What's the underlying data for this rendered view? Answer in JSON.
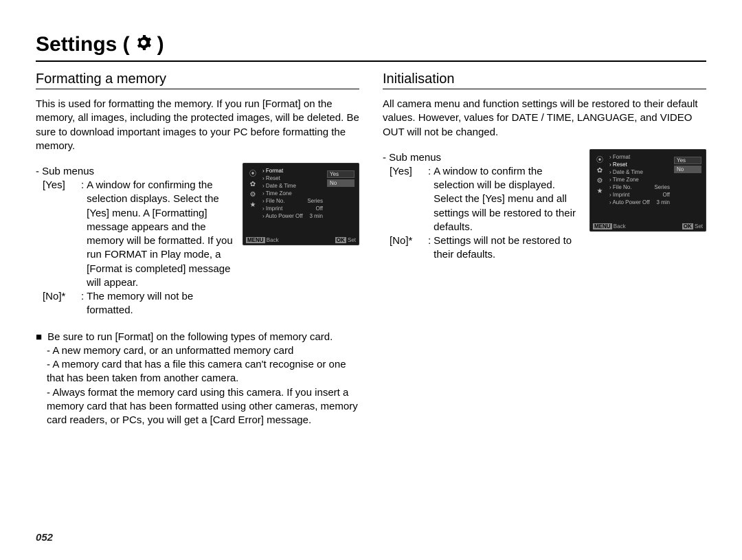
{
  "title_text": "Settings (",
  "title_close": ")",
  "page_number": "052",
  "left": {
    "heading": "Formatting a memory",
    "intro": "This is used for formatting the memory. If you run [Format] on the memory, all images, including the protected images, will be deleted. Be sure to download important images to your PC before formatting the memory.",
    "sub_menus_label": "- Sub menus",
    "yes_label": "[Yes]",
    "yes_text": "A window for confirming the selection displays. Select the [Yes] menu. A [Formatting] message appears and the memory will be formatted. If you run FORMAT in Play mode, a [Format is completed] message will appear.",
    "no_label": "[No]*",
    "no_text": "The memory will not be formatted.",
    "bullet_lead": "Be sure to run [Format] on the following types of memory card.",
    "bullet_a": "- A new memory card, or an unformatted memory card",
    "bullet_b": "- A memory card that has a file this camera can't recognise or one that has been taken from another camera.",
    "bullet_c": "- Always format the memory card using this camera. If you insert a memory card that has been formatted using other cameras, memory card readers, or PCs, you will get a [Card Error] message."
  },
  "right": {
    "heading": "Initialisation",
    "intro": "All camera menu and function settings will be restored to their default values. However, values for DATE / TIME, LANGUAGE, and VIDEO OUT will not be changed.",
    "sub_menus_label": "- Sub menus",
    "yes_label": "[Yes]",
    "yes_text": "A window to confirm the selection will be displayed. Select the [Yes] menu and all settings will be restored to their defaults.",
    "no_label": "[No]*",
    "no_text": "Settings will not be restored to their defaults."
  },
  "screen_left": {
    "items": [
      {
        "l": "Format",
        "r": ""
      },
      {
        "l": "Reset",
        "r": ""
      },
      {
        "l": "Date & Time",
        "r": ""
      },
      {
        "l": "Time Zone",
        "r": ""
      },
      {
        "l": "File No.",
        "r": "Series"
      },
      {
        "l": "Imprint",
        "r": "Off"
      },
      {
        "l": "Auto Power Off",
        "r": "3 min"
      }
    ],
    "hl": 0,
    "opts": [
      "Yes",
      "No"
    ],
    "opt_sel": 1,
    "back": "Back",
    "set": "Set"
  },
  "screen_right": {
    "items": [
      {
        "l": "Format",
        "r": ""
      },
      {
        "l": "Reset",
        "r": ""
      },
      {
        "l": "Date & Time",
        "r": ""
      },
      {
        "l": "Time Zone",
        "r": ""
      },
      {
        "l": "File No.",
        "r": "Series"
      },
      {
        "l": "Imprint",
        "r": "Off"
      },
      {
        "l": "Auto Power Off",
        "r": "3 min"
      }
    ],
    "hl": 1,
    "opts": [
      "Yes",
      "No"
    ],
    "opt_sel": 1,
    "back": "Back",
    "set": "Set"
  }
}
